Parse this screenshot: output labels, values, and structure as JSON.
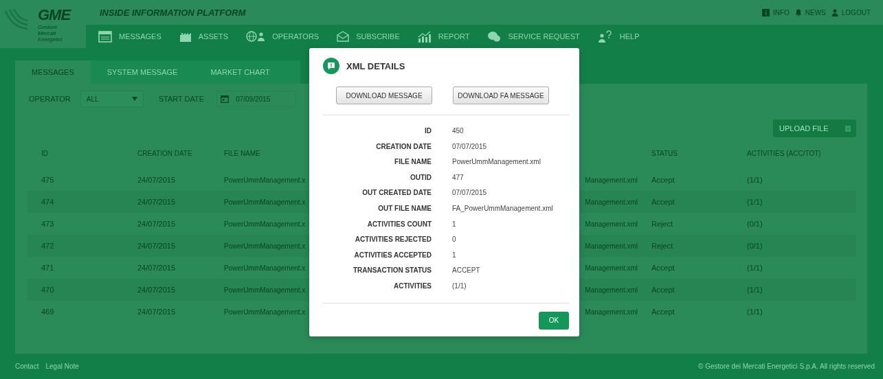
{
  "header": {
    "logo_text": "GME",
    "logo_subtitle": "Gestore Mercati Energetici",
    "platform_title": "INSIDE INFORMATION PLATFORM",
    "links": [
      {
        "label": "INFO",
        "kind": "info"
      },
      {
        "label": "NEWS",
        "kind": "bell"
      },
      {
        "label": "LOGOUT",
        "kind": "user"
      }
    ]
  },
  "nav": [
    {
      "label": "MESSAGES",
      "kind": "messages"
    },
    {
      "label": "ASSETS",
      "kind": "assets"
    },
    {
      "label": "OPERATORS",
      "kind": "operators"
    },
    {
      "label": "SUBSCRIBE",
      "kind": "subscribe"
    },
    {
      "label": "REPORT",
      "kind": "report"
    },
    {
      "label": "SERVICE REQUEST",
      "kind": "service"
    },
    {
      "label": "HELP",
      "kind": "help"
    }
  ],
  "tabs": [
    {
      "label": "MESSAGES",
      "selected": true
    },
    {
      "label": "SYSTEM MESSAGE",
      "selected": false
    },
    {
      "label": "MARKET CHART",
      "selected": false
    }
  ],
  "filters": {
    "operator_label": "OPERATOR",
    "operator_value": "ALL",
    "start_date_label": "START DATE",
    "start_date_value": "07/09/2015"
  },
  "upload_button": "UPLOAD FILE",
  "table": {
    "columns": [
      "ID",
      "CREATION DATE",
      "FILE NAME",
      "STATUS",
      "ACTIVITIES (ACC/TOT)"
    ],
    "rows": [
      {
        "id": "475",
        "creation_date": "24/07/2015",
        "file_name": "PowerUmmManagement.x",
        "column_4": "Management.xml",
        "status": "Accept",
        "activities": "(1/1)"
      },
      {
        "id": "474",
        "creation_date": "24/07/2015",
        "file_name": "PowerUmmManagement.x",
        "column_4": "Management.xml",
        "status": "Accept",
        "activities": "(1/1)"
      },
      {
        "id": "473",
        "creation_date": "24/07/2015",
        "file_name": "PowerUmmManagement.x",
        "column_4": "Management.xml",
        "status": "Reject",
        "activities": "(0/1)"
      },
      {
        "id": "472",
        "creation_date": "24/07/2015",
        "file_name": "PowerUmmManagement.x",
        "column_4": "Management.xml",
        "status": "Reject",
        "activities": "(0/1)"
      },
      {
        "id": "471",
        "creation_date": "24/07/2015",
        "file_name": "PowerUmmManagement.x",
        "column_4": "Management.xml",
        "status": "Accept",
        "activities": "(1/1)"
      },
      {
        "id": "470",
        "creation_date": "24/07/2015",
        "file_name": "PowerUmmManagement.x",
        "column_4": "Management.xml",
        "status": "Accept",
        "activities": "(1/1)"
      },
      {
        "id": "469",
        "creation_date": "24/07/2015",
        "file_name": "PowerUmmManagement.x",
        "column_4": "Management.xml",
        "status": "Accept",
        "activities": "(1/1)"
      }
    ]
  },
  "modal": {
    "title": "XML DETAILS",
    "buttons": [
      "DOWNLOAD MESSAGE",
      "DOWNLOAD FA MESSAGE"
    ],
    "fields": [
      {
        "label": "ID",
        "value": "450"
      },
      {
        "label": "CREATION DATE",
        "value": "07/07/2015"
      },
      {
        "label": "FILE NAME",
        "value": "PowerUmmManagement.xml"
      },
      {
        "label": "OUTID",
        "value": "477"
      },
      {
        "label": "OUT CREATED DATE",
        "value": "07/07/2015"
      },
      {
        "label": "OUT FILE NAME",
        "value": "FA_PowerUmmManagement.xml"
      },
      {
        "label": "ACTIVITIES COUNT",
        "value": "1"
      },
      {
        "label": "ACTIVITIES REJECTED",
        "value": "0"
      },
      {
        "label": "ACTIVITIES ACCEPTED",
        "value": "1"
      },
      {
        "label": "TRANSACTION STATUS",
        "value": "ACCEPT"
      },
      {
        "label": "ACTIVITIES",
        "value": "(1/1)"
      }
    ],
    "ok_button": "OK"
  },
  "footer": {
    "links": [
      "Contact",
      "Legal Note"
    ],
    "copyright": "© Gestore dei Mercati Energetici S.p.A. All rights reserved"
  }
}
